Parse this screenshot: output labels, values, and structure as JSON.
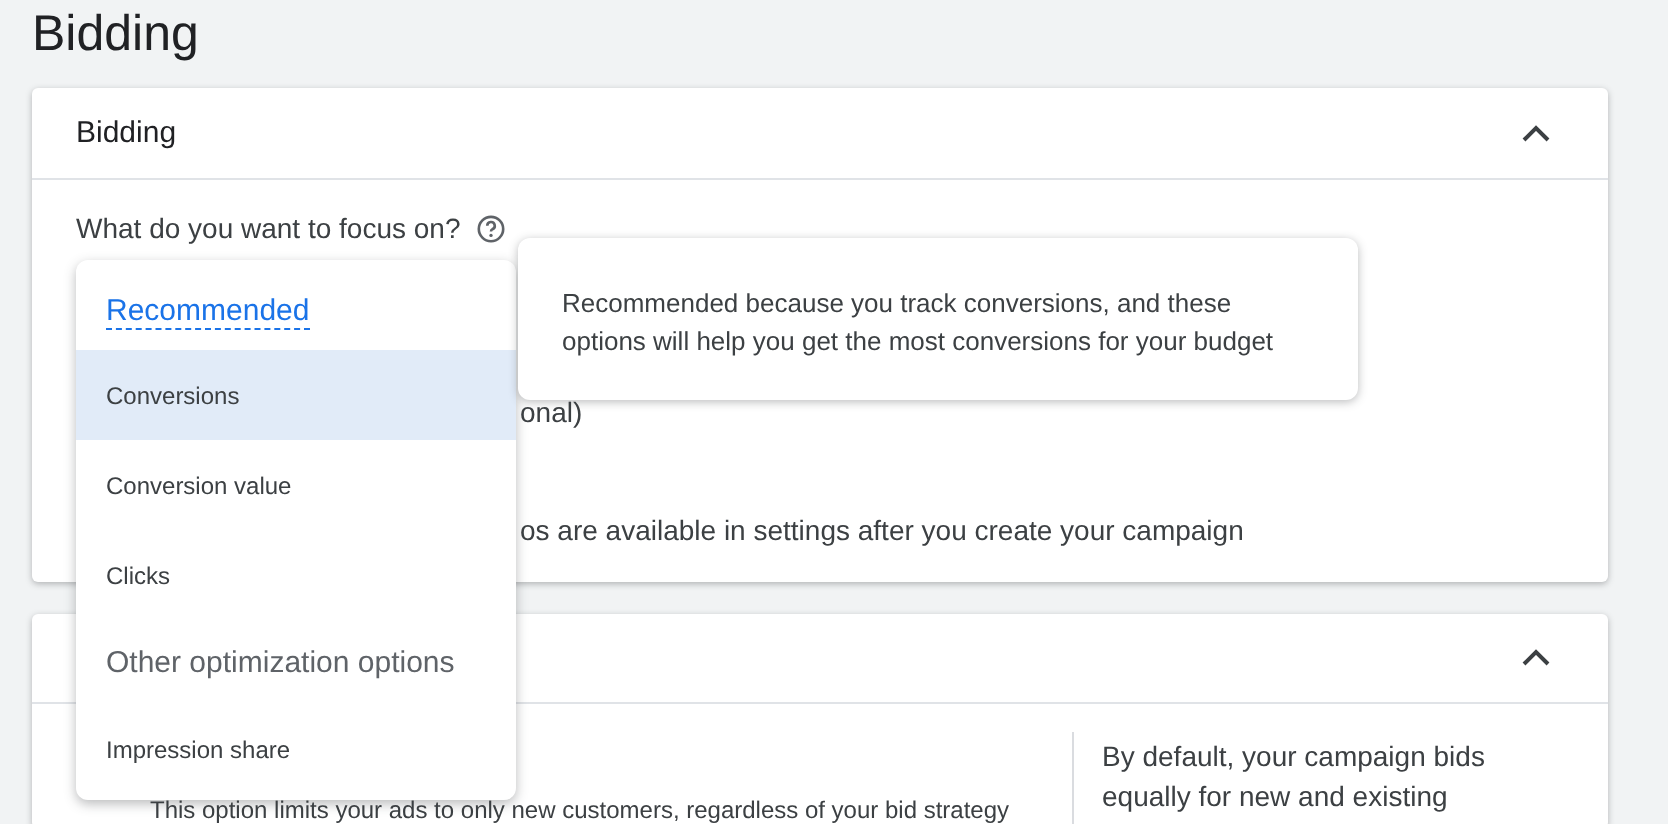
{
  "page_title": "Bidding",
  "bidding_card": {
    "title": "Bidding",
    "expanded": true,
    "question": "What do you want to focus on?",
    "text_1": "onal)",
    "text_2": "os are available in settings after you create your campaign"
  },
  "second_card": {
    "expanded": true,
    "left_text": "This option limits your ads to only new customers, regardless of your bid strategy",
    "right_text": "By default, your campaign bids equally for new and existing"
  },
  "dropdown": {
    "items": [
      {
        "kind": "recommended",
        "label": "Recommended"
      },
      {
        "kind": "option",
        "label": "Conversions",
        "selected": true
      },
      {
        "kind": "option",
        "label": "Conversion value",
        "selected": false
      },
      {
        "kind": "option",
        "label": "Clicks",
        "selected": false
      },
      {
        "kind": "header",
        "label": "Other optimization options"
      },
      {
        "kind": "option",
        "label": "Impression share",
        "selected": false
      }
    ]
  },
  "tooltip": {
    "text": "Recommended because you track conversions, and these options will help you get the most conversions for your budget"
  }
}
